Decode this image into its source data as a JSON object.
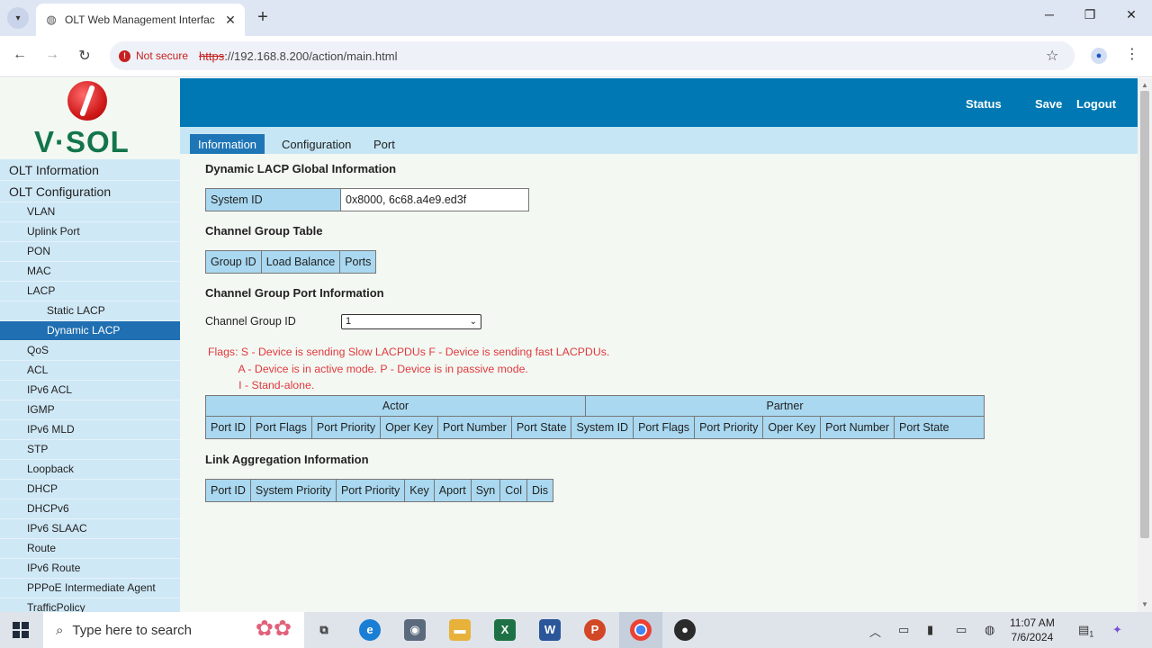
{
  "browser": {
    "tab_title": "OLT Web Management Interfac",
    "security_label": "Not secure",
    "url_protocol": "https",
    "url_rest": "://192.168.8.200/action/main.html"
  },
  "brand": {
    "logo_text": "V·SOL"
  },
  "topbar": {
    "status": "Status",
    "save": "Save",
    "logout": "Logout"
  },
  "subtabs": [
    "Information",
    "Configuration",
    "Port"
  ],
  "sidebar": {
    "items": [
      {
        "label": "OLT Information",
        "level": "top"
      },
      {
        "label": "OLT Configuration",
        "level": "top"
      },
      {
        "label": "VLAN",
        "level": "l2"
      },
      {
        "label": "Uplink Port",
        "level": "l2"
      },
      {
        "label": "PON",
        "level": "l2"
      },
      {
        "label": "MAC",
        "level": "l2"
      },
      {
        "label": "LACP",
        "level": "l2"
      },
      {
        "label": "Static LACP",
        "level": "l3"
      },
      {
        "label": "Dynamic LACP",
        "level": "l3",
        "active": true
      },
      {
        "label": "QoS",
        "level": "l2"
      },
      {
        "label": "ACL",
        "level": "l2"
      },
      {
        "label": "IPv6 ACL",
        "level": "l2"
      },
      {
        "label": "IGMP",
        "level": "l2"
      },
      {
        "label": "IPv6 MLD",
        "level": "l2"
      },
      {
        "label": "STP",
        "level": "l2"
      },
      {
        "label": "Loopback",
        "level": "l2"
      },
      {
        "label": "DHCP",
        "level": "l2"
      },
      {
        "label": "DHCPv6",
        "level": "l2"
      },
      {
        "label": "IPv6 SLAAC",
        "level": "l2"
      },
      {
        "label": "Route",
        "level": "l2"
      },
      {
        "label": "IPv6 Route",
        "level": "l2"
      },
      {
        "label": "PPPoE Intermediate Agent",
        "level": "l2"
      },
      {
        "label": "TrafficPolicy",
        "level": "l2"
      }
    ]
  },
  "main": {
    "global_title": "Dynamic LACP Global Information",
    "system_id_label": "System ID",
    "system_id_value": "0x8000, 6c68.a4e9.ed3f",
    "channel_table_title": "Channel Group Table",
    "channel_table_headers": [
      "Group ID",
      "Load Balance",
      "Ports"
    ],
    "port_info_title": "Channel Group Port Information",
    "channel_group_label": "Channel Group ID",
    "channel_group_selected": "1",
    "flags_text": "Flags: S - Device is sending Slow LACPDUs F - Device is sending fast LACPDUs.\n          A - Device is in active mode. P - Device is in passive mode.\n          I - Stand-alone.",
    "actor_label": "Actor",
    "partner_label": "Partner",
    "actor_columns": [
      "Port ID",
      "Port Flags",
      "Port Priority",
      "Oper Key",
      "Port Number",
      "Port State"
    ],
    "partner_columns": [
      "System ID",
      "Port Flags",
      "Port Priority",
      "Oper Key",
      "Port Number",
      "Port State"
    ],
    "link_agg_title": "Link Aggregation Information",
    "link_agg_headers": [
      "Port ID",
      "System Priority",
      "Port Priority",
      "Key",
      "Aport",
      "Syn",
      "Col",
      "Dis"
    ]
  },
  "taskbar": {
    "search_placeholder": "Type here to search",
    "time": "11:07 AM",
    "date": "7/6/2024",
    "notification_count": "1"
  },
  "colors": {
    "topbar": "#0078b4",
    "sidebar": "#cfe8f6",
    "active": "#1f6fb2",
    "header_cell": "#a9d8f0",
    "flags": "#e0393e",
    "logo": "#13754b"
  }
}
